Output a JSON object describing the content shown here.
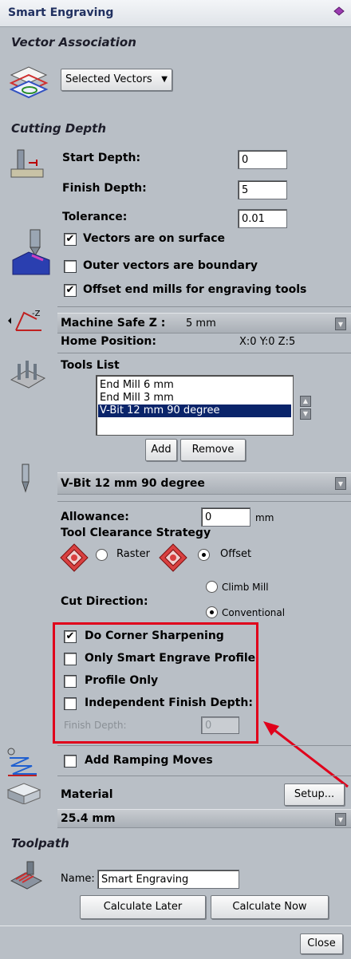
{
  "window": {
    "title": "Smart Engraving"
  },
  "vector_association": {
    "header": "Vector Association",
    "selection_dropdown": "Selected Vectors"
  },
  "cutting_depth": {
    "header": "Cutting Depth",
    "start_depth_label": "Start Depth:",
    "start_depth_value": "0",
    "finish_depth_label": "Finish Depth:",
    "finish_depth_value": "5",
    "tolerance_label": "Tolerance:",
    "tolerance_value": "0.01",
    "vectors_on_surface": {
      "label": "Vectors are on surface",
      "checked": true
    },
    "outer_vectors_boundary": {
      "label": "Outer vectors are boundary",
      "checked": false
    },
    "offset_end_mills": {
      "label": "Offset end mills for engraving tools",
      "checked": true
    }
  },
  "machine": {
    "safe_z_label": "Machine Safe Z :",
    "safe_z_value": "5 mm",
    "home_position_label": "Home Position:",
    "home_position_value": "X:0 Y:0 Z:5"
  },
  "tools": {
    "header": "Tools List",
    "items": [
      "End Mill 6 mm",
      "End Mill 3 mm",
      "V-Bit 12 mm 90 degree"
    ],
    "selected_index": 2,
    "add_label": "Add",
    "remove_label": "Remove"
  },
  "selected_tool": {
    "name": "V-Bit 12 mm 90 degree"
  },
  "settings": {
    "allowance_label": "Allowance:",
    "allowance_value": "0",
    "allowance_unit": "mm",
    "clearance_strategy_label": "Tool Clearance Strategy",
    "raster_label": "Raster",
    "offset_label": "Offset",
    "clearance_selected": "Offset",
    "cut_direction_label": "Cut Direction:",
    "climb_label": "Climb Mill",
    "conventional_label": "Conventional",
    "cut_direction_selected": "Conventional",
    "corner_sharpening": {
      "label": "Do Corner Sharpening",
      "checked": true
    },
    "only_profile": {
      "label": "Only Smart Engrave Profile",
      "checked": false
    },
    "profile_only": {
      "label": "Profile Only",
      "checked": false
    },
    "independent_finish": {
      "label": "Independent Finish Depth:",
      "checked": false
    },
    "finish_depth_label": "Finish Depth:",
    "finish_depth_value": "0"
  },
  "ramping": {
    "label": "Add Ramping Moves",
    "checked": false
  },
  "material": {
    "label": "Material",
    "setup_label": "Setup...",
    "thickness": "25.4 mm"
  },
  "toolpath": {
    "header": "Toolpath",
    "name_label": "Name:",
    "name_value": "Smart Engraving",
    "calc_later_label": "Calculate Later",
    "calc_now_label": "Calculate Now"
  },
  "footer": {
    "close_label": "Close"
  },
  "colors": {
    "highlight_box": "#e0001b",
    "selection": "#0a246a",
    "title": "#203060"
  },
  "check_glyph": "✔",
  "dropdown_glyph": "▼",
  "up_glyph": "▲",
  "down_glyph": "▼"
}
